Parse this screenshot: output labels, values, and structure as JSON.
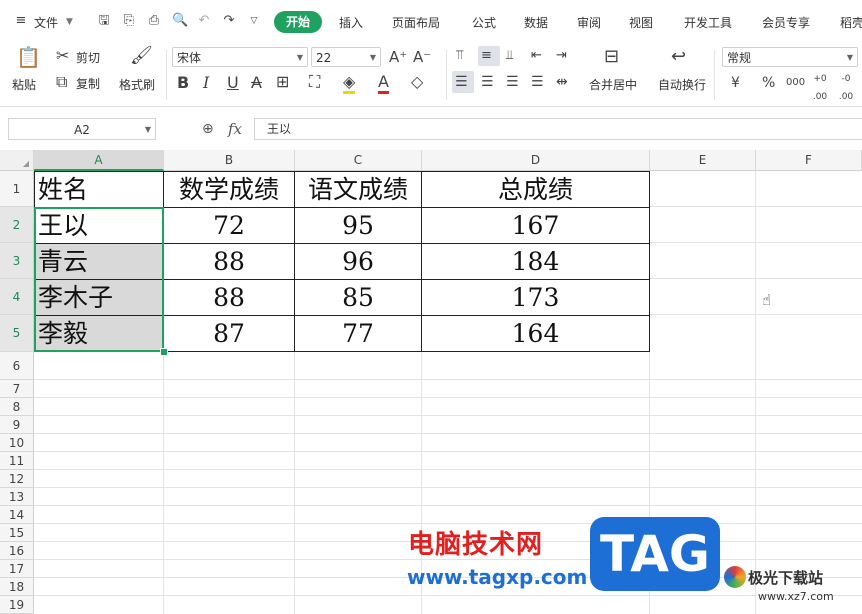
{
  "menubar": {
    "file_label": "文件",
    "tabs": [
      "开始",
      "插入",
      "页面布局",
      "公式",
      "数据",
      "审阅",
      "视图",
      "开发工具",
      "会员专享",
      "稻壳"
    ]
  },
  "ribbon": {
    "paste": "粘贴",
    "cut": "剪切",
    "copy": "复制",
    "format_painter": "格式刷",
    "font_name": "宋体",
    "font_size": "22",
    "merge_center": "合并居中",
    "auto_wrap": "自动换行",
    "number_format": "常规",
    "bold": "B",
    "italic": "I",
    "underline": "U",
    "strike": "A",
    "font_color": "A",
    "currency": "¥",
    "percent": "%",
    "thousands": "000",
    "inc_decimal": "+0 .00",
    "dec_decimal": "-0 .00"
  },
  "formula_bar": {
    "name_box": "A2",
    "fx": "fx",
    "content": "王以"
  },
  "sheet": {
    "columns": [
      "A",
      "B",
      "C",
      "D",
      "E",
      "F"
    ],
    "rows": [
      "1",
      "2",
      "3",
      "4",
      "5",
      "6",
      "7",
      "8",
      "9",
      "10",
      "11",
      "12",
      "13",
      "14",
      "15",
      "16",
      "17",
      "18",
      "19"
    ],
    "header": [
      "姓名",
      "数学成绩",
      "语文成绩",
      "总成绩"
    ],
    "data": [
      [
        "王以",
        "72",
        "95",
        "167"
      ],
      [
        "青云",
        "88",
        "96",
        "184"
      ],
      [
        "李木子",
        "88",
        "85",
        "173"
      ],
      [
        "李毅",
        "87",
        "77",
        "164"
      ]
    ]
  },
  "watermark": {
    "cn": "电脑技术网",
    "url": "www.tagxp.com",
    "tag": "TAG",
    "site": "极光下载站",
    "site_url": "www.xz7.com"
  }
}
